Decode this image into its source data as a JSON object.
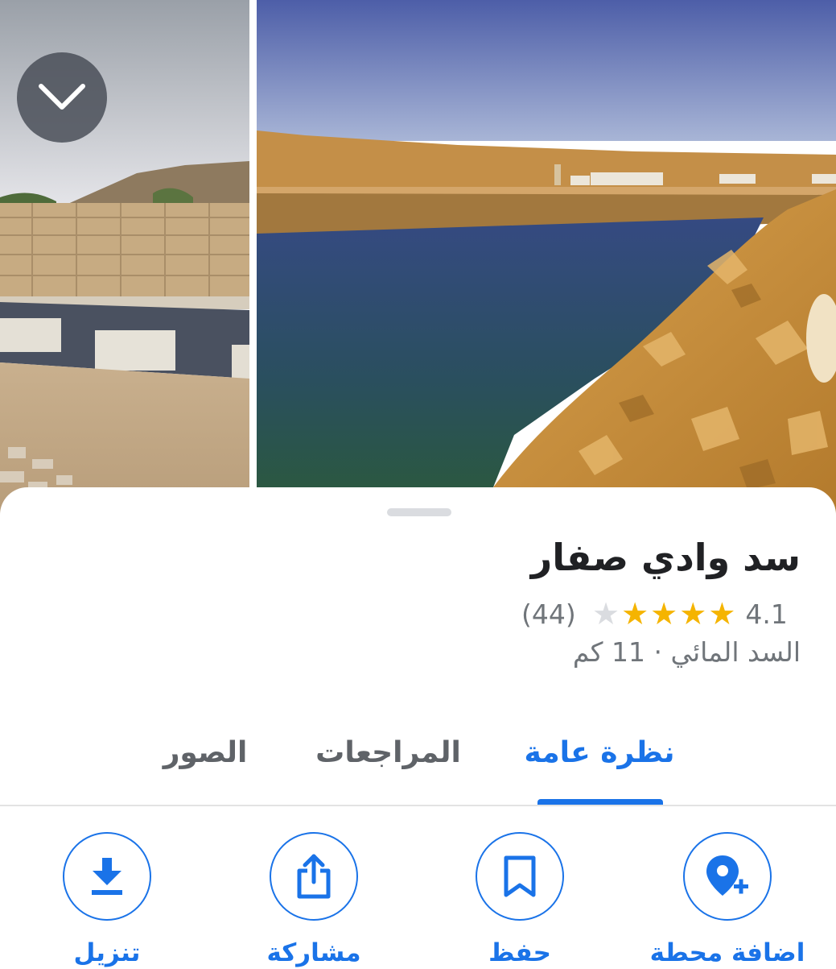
{
  "photos": {
    "collapse_icon": "chevron-down-icon",
    "share_icon": "share-icon",
    "more_icon": "more-horizontal-icon"
  },
  "place": {
    "title": "سد وادي صفار",
    "rating": "4.1",
    "stars_filled": 4,
    "stars_total": 5,
    "review_count": "(44)",
    "category_distance": "السد المائي · 11 كم"
  },
  "tabs": [
    {
      "label": "نظرة عامة",
      "selected": true
    },
    {
      "label": "المراجعات",
      "selected": false
    },
    {
      "label": "الصور",
      "selected": false
    }
  ],
  "actions": {
    "add_stop": {
      "label": "اضافة محطة",
      "icon": "add-location-icon"
    },
    "save": {
      "label": "حفظ",
      "icon": "bookmark-icon"
    },
    "share": {
      "label": "مشاركة",
      "icon": "share-icon"
    },
    "download": {
      "label": "تنزيل",
      "icon": "download-icon"
    }
  },
  "colors": {
    "accent": "#1a73e8",
    "star": "#f5b400",
    "star_empty": "#dadce0",
    "secondary_text": "#70757a",
    "title_text": "#202124"
  }
}
